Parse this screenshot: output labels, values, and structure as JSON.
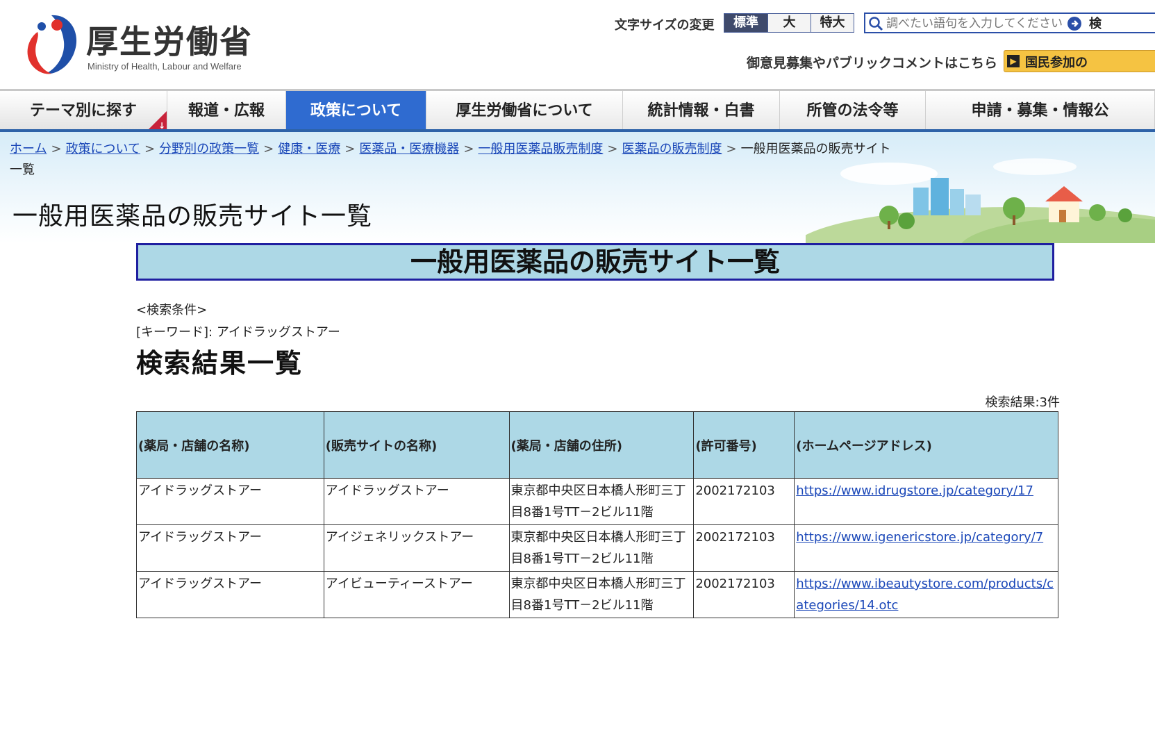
{
  "header": {
    "logo_title": "厚生労働省",
    "logo_subtitle": "Ministry of Health, Labour and Welfare",
    "fontsize_label": "文字サイズの変更",
    "fontsize_options": [
      "標準",
      "大",
      "特大"
    ],
    "fontsize_selected": "標準",
    "search_placeholder": "調べたい語句を入力してください",
    "search_more": "検",
    "opinion_text": "御意見募集やパブリックコメントはこちら",
    "opinion_button": "国民参加の"
  },
  "nav": {
    "items": [
      "テーマ別に探す",
      "報道・広報",
      "政策について",
      "厚生労働省について",
      "統計情報・白書",
      "所管の法令等",
      "申請・募集・情報公"
    ],
    "active": "政策について"
  },
  "breadcrumb": {
    "links": [
      "ホーム",
      "政策について",
      "分野別の政策一覧",
      "健康・医療",
      "医薬品・医療機器",
      "一般用医薬品販売制度",
      "医薬品の販売制度"
    ],
    "current": "一般用医薬品の販売サイト一覧"
  },
  "page_title": "一般用医薬品の販売サイト一覧",
  "main": {
    "heading": "一般用医薬品の販売サイト一覧",
    "condition_label": "<検索条件>",
    "keyword_line": "[キーワード]: アイドラッグストアー",
    "results_heading": "検索結果一覧",
    "results_count": "検索結果:3件"
  },
  "table": {
    "headers": [
      "(薬局・店舗の名称)",
      "(販売サイトの名称)",
      "(薬局・店舗の住所)",
      "(許可番号)",
      "(ホームページアドレス)"
    ],
    "rows": [
      {
        "store": "アイドラッグストアー",
        "site": "アイドラッグストアー",
        "address": "東京都中央区日本橋人形町三丁目8番1号TT－2ビル11階",
        "permit": "2002172103",
        "url": "https://www.idrugstore.jp/category/17"
      },
      {
        "store": "アイドラッグストアー",
        "site": "アイジェネリックストアー",
        "address": "東京都中央区日本橋人形町三丁目8番1号TT－2ビル11階",
        "permit": "2002172103",
        "url": "https://www.igenericstore.jp/category/7"
      },
      {
        "store": "アイドラッグストアー",
        "site": "アイビューティーストアー",
        "address": "東京都中央区日本橋人形町三丁目8番1号TT－2ビル11階",
        "permit": "2002172103",
        "url": "https://www.ibeautystore.com/products/categories/14.otc"
      }
    ]
  },
  "colors": {
    "nav_active": "#2f6bd0",
    "table_header": "#add8e6",
    "heading_border": "#1f1fa0",
    "link": "#1a47b8"
  }
}
